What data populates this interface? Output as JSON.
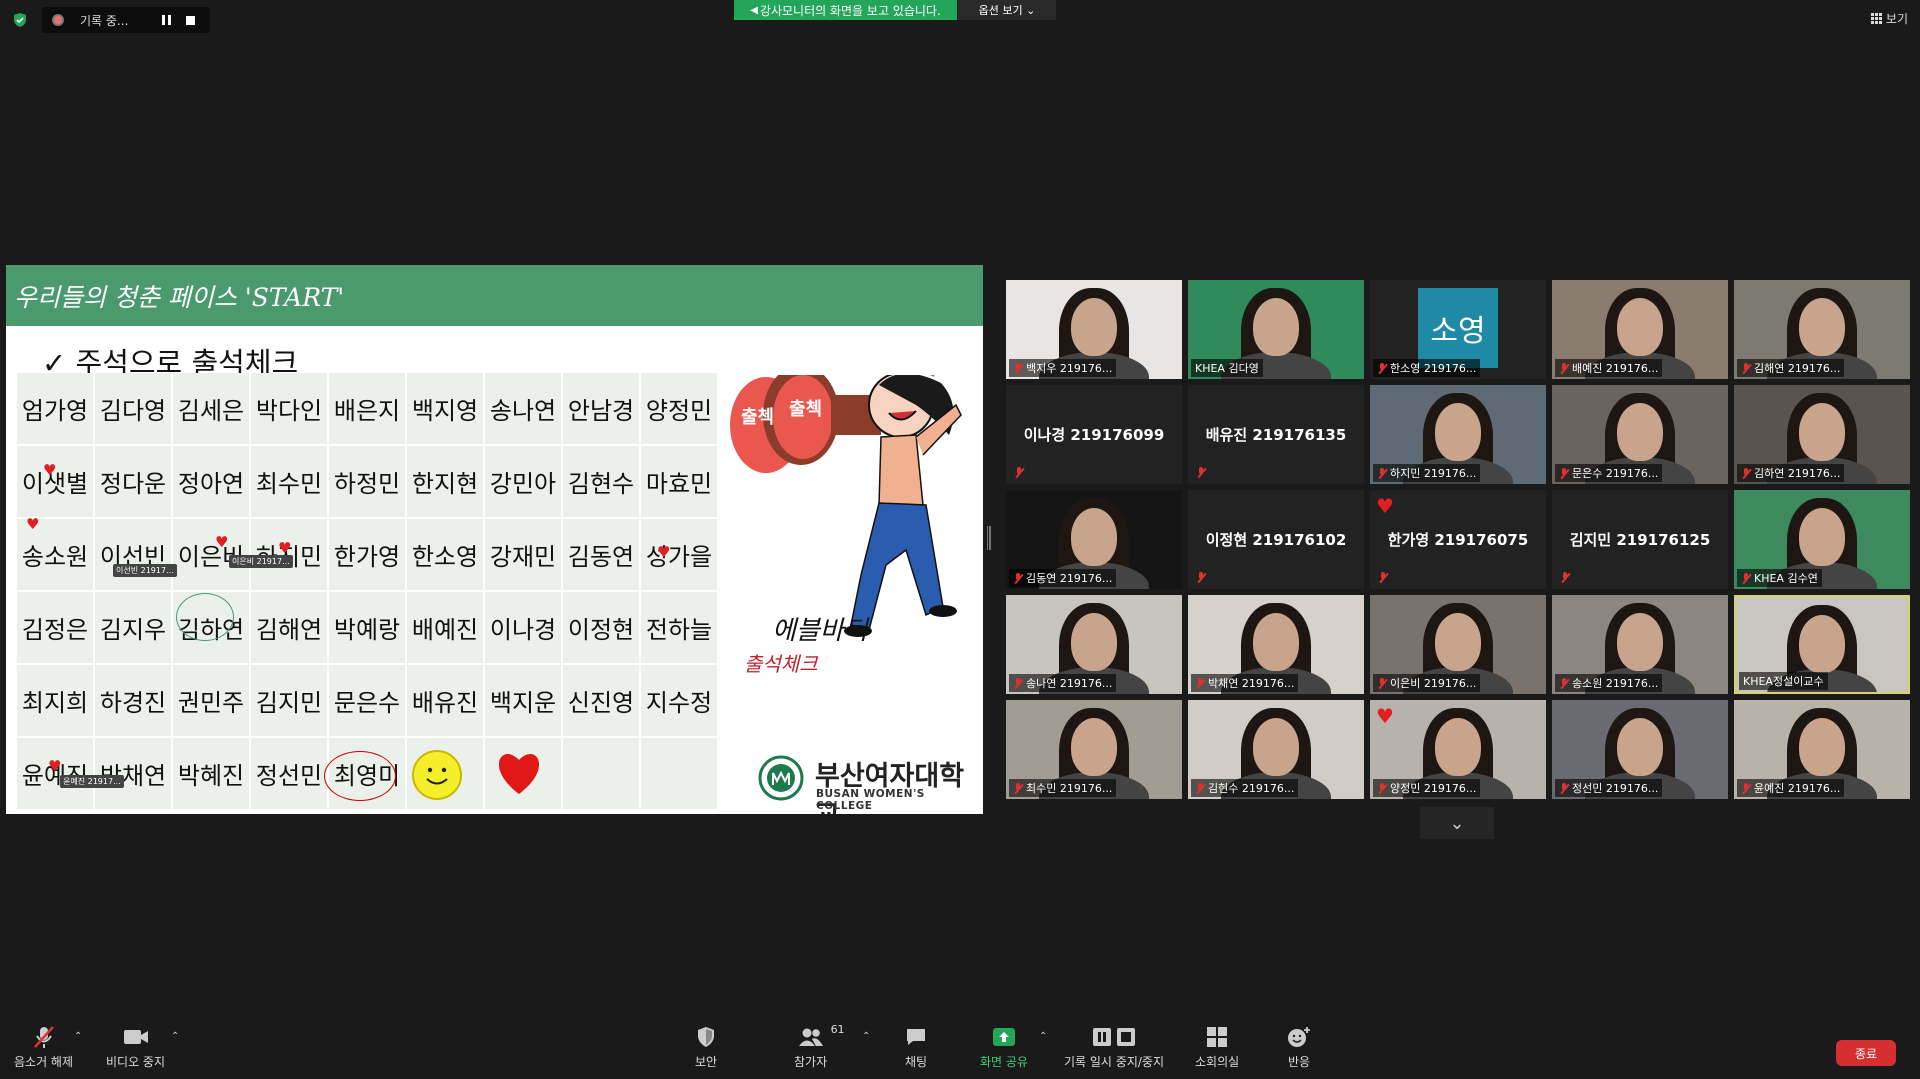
{
  "top_bar": {
    "recording_label": "기록 중...",
    "screen_share_banner": "강사모니터의 화면을 보고 있습니다.",
    "view_options_label": "옵션 보기 ⌄",
    "view_button_label": "보기"
  },
  "slide": {
    "title": "우리들의 청춘 페이스 'START'",
    "subtitle": "✓ 주석으로 출석체크",
    "names": [
      [
        "엄가영",
        "김다영",
        "김세은",
        "박다인",
        "배은지",
        "백지영",
        "송나연",
        "안남경",
        "양정민"
      ],
      [
        "이샛별",
        "정다운",
        "정아연",
        "최수민",
        "하정민",
        "한지현",
        "강민아",
        "김현수",
        "마효민"
      ],
      [
        "송소원",
        "이선빈",
        "이은비",
        "하지민",
        "한가영",
        "한소영",
        "강재민",
        "김동연",
        "성가을"
      ],
      [
        "김정은",
        "김지우",
        "김하연",
        "김해연",
        "박예랑",
        "배예진",
        "이나경",
        "이정현",
        "전하늘"
      ],
      [
        "최지희",
        "하경진",
        "권민주",
        "김지민",
        "문은수",
        "배유진",
        "백지운",
        "신진영",
        "지수정"
      ],
      [
        "윤예진",
        "박채연",
        "박혜진",
        "정선민",
        "최영미",
        "",
        "",
        "",
        ""
      ]
    ],
    "annotation_tags": [
      "이선빈 21917...",
      "이은비 21917...",
      "윤예진 21917..."
    ],
    "stamp_text_left": "출첵",
    "stamp_text_right": "출첵",
    "cartoon_line1": "에블바디",
    "cartoon_line2": "출석체크",
    "school_name": "부산여자대학교",
    "school_name_en": "BUSAN WOMEN'S COLLEGE"
  },
  "participants": [
    {
      "name": "백지우 219176...",
      "muted": true,
      "type": "video"
    },
    {
      "name": "KHEA 김다영",
      "muted": false,
      "type": "video"
    },
    {
      "name": "한소영 219176...",
      "muted": true,
      "type": "avatar",
      "avatar_text": "소영"
    },
    {
      "name": "배예진 219176...",
      "muted": true,
      "type": "video"
    },
    {
      "name": "김해연 219176...",
      "muted": true,
      "type": "video"
    },
    {
      "name": "이나경 219176099",
      "muted": true,
      "type": "name"
    },
    {
      "name": "배유진 219176135",
      "muted": true,
      "type": "name"
    },
    {
      "name": "하지민 219176...",
      "muted": true,
      "type": "video"
    },
    {
      "name": "문은수 219176...",
      "muted": true,
      "type": "video"
    },
    {
      "name": "김하연 219176...",
      "muted": true,
      "type": "video"
    },
    {
      "name": "김동연 219176...",
      "muted": true,
      "type": "video"
    },
    {
      "name": "이정현 219176102",
      "muted": true,
      "type": "name"
    },
    {
      "name": "한가영 219176075",
      "muted": true,
      "type": "name",
      "reaction": "heart"
    },
    {
      "name": "김지민 219176125",
      "muted": true,
      "type": "name"
    },
    {
      "name": "KHEA 김수연",
      "muted": true,
      "type": "video"
    },
    {
      "name": "송나연 219176...",
      "muted": true,
      "type": "video"
    },
    {
      "name": "박채연 219176...",
      "muted": true,
      "type": "video"
    },
    {
      "name": "이은비 219176...",
      "muted": true,
      "type": "video"
    },
    {
      "name": "송소원 219176...",
      "muted": true,
      "type": "video"
    },
    {
      "name": "KHEA정설이교수",
      "muted": false,
      "type": "video",
      "active": true
    },
    {
      "name": "최수민 219176...",
      "muted": true,
      "type": "video"
    },
    {
      "name": "김현수 219176...",
      "muted": true,
      "type": "video"
    },
    {
      "name": "양정민 219176...",
      "muted": true,
      "type": "video",
      "reaction": "heart"
    },
    {
      "name": "정선민 219176...",
      "muted": true,
      "type": "video"
    },
    {
      "name": "윤예진 219176...",
      "muted": true,
      "type": "video"
    }
  ],
  "toolbar": {
    "unmute_label": "음소거 해제",
    "stop_video_label": "비디오 중지",
    "security_label": "보안",
    "participants_label": "참가자",
    "participants_count": "61",
    "chat_label": "채팅",
    "share_screen_label": "화면 공유",
    "pause_record_label": "기록 일시 중지/중지",
    "breakout_label": "소회의실",
    "reactions_label": "반응",
    "end_label": "종료"
  },
  "colors": {
    "background": "#1a1a1a",
    "slide_header": "#4b9a6e",
    "share_banner": "#23a55a",
    "end_button": "#d62f2f",
    "active_speaker_border": "#d7d46a"
  }
}
